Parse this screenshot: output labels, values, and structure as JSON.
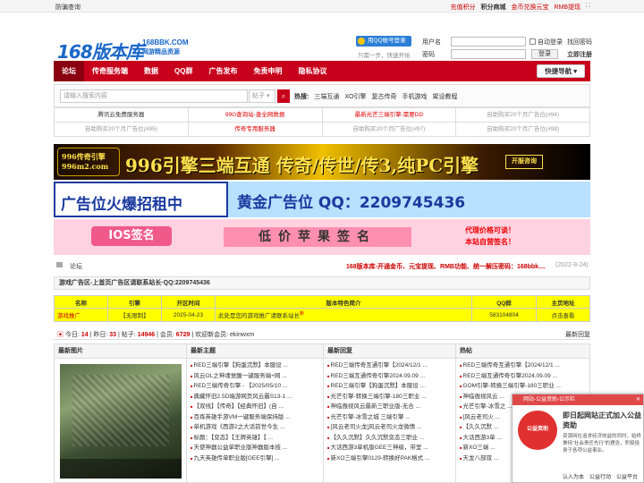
{
  "topbar": {
    "left": "防骗查询",
    "links": [
      "充值积分",
      "积分商城",
      "金币兑换元宝",
      "RMB提现"
    ]
  },
  "logo": {
    "main": "168版本库",
    "url": "168BBK.COM",
    "slogan": "网游精品资源"
  },
  "qq_login": {
    "label": "用QQ帐号登录",
    "sub": "只需一步，快速开始"
  },
  "login": {
    "user_label": "用户名",
    "pass_label": "密码",
    "auto_login": "自动登录",
    "forgot": "找回密码",
    "login_btn": "登录",
    "register": "立即注册"
  },
  "nav": {
    "items": [
      "论坛",
      "传奇服务端",
      "数据",
      "QQ群",
      "广告发布",
      "免责申明",
      "隐私协议"
    ],
    "quick": "快捷导航"
  },
  "search": {
    "placeholder": "请输入搜索内容",
    "select": "帖子",
    "hot_label": "热搜:",
    "hot": [
      "三端互通",
      "XO引擎",
      "复古传奇",
      "手机游戏",
      "架设教程"
    ]
  },
  "adlinks": [
    [
      {
        "t": "腾讯云免费服务器",
        "c": ""
      },
      {
        "t": "99G查询站-查全网数据",
        "c": "red"
      },
      {
        "t": "最新光芒三端引擎-需要DD",
        "c": "red"
      },
      {
        "t": "自助购买20个月广告位(#94)",
        "c": "gray"
      }
    ],
    [
      {
        "t": "自助购买20个月广告位(#95)",
        "c": "gray"
      },
      {
        "t": "传奇专用服务器",
        "c": "red"
      },
      {
        "t": "自助购买20个月广告位(#97)",
        "c": "gray"
      },
      {
        "t": "自助购买20个月广告位(#98)",
        "c": "gray"
      }
    ]
  ],
  "banners": {
    "b1_logo": "996传奇引擎 996m2.com",
    "b1_text": "996引擎三端互通 传奇/传世/传3,纯PC引擎",
    "b1_btn": "开服咨询",
    "b2_left": "广告位火爆招租中",
    "b2_right": "黄金广告位 QQ：2209745436",
    "b3_ios": "IOS签名",
    "b3_mid": "低价苹果签名",
    "b3_r1": "代理价格可谈！",
    "b3_r2": "本站自营签名！"
  },
  "crumb": {
    "text": "论坛",
    "news": "168版本库-开通金币、元宝提现、RMB功能、统一解压密码：168bbk....",
    "date": "(2022-8-24)"
  },
  "forum_title": "游戏广告区-上首页广告区请联系站长·QQ:2209745436",
  "ad_table": {
    "headers": [
      "名称",
      "引擎",
      "开区时间",
      "版本特色简介",
      "QQ群",
      "主页地址"
    ],
    "rows": [
      [
        "游戏推广",
        "【无限制】",
        "2025-04-23",
        "此处是您的游戏推广请联系站长",
        "583104804",
        "点击查看"
      ]
    ],
    "badge": "新"
  },
  "stats": {
    "today_l": "今日:",
    "today": "14",
    "yest_l": "昨日:",
    "yest": "33",
    "posts_l": "帖子:",
    "posts": "14946",
    "members_l": "会员:",
    "members": "6729",
    "new_l": "欢迎新会员:",
    "new": "ekinwxm",
    "latest": "最新回复"
  },
  "cols": {
    "c1": "最新图片",
    "c2": {
      "title": "最新主题",
      "items": [
        "RED三端引擎【狗蛋沉默】本服设 ...",
        "风云OL之神魂觉醒一键服务端+网 ...",
        "RED三端传奇引擎 - 【2025/05/10 ...",
        "典藏怀旧2.5D端游网页风云霸S13-1 ...",
        "【双线】【传奇】【经典怀旧】(自 ...",
        "百炼英雄手游VM一键服务端保持版 ...",
        "单机游戏《西游2之大话前世今生 ...",
        "标题：【变态】【王牌英雄】【 ...",
        "天使神器公益单职业版神器版本技 ...",
        "九天英雄传单职业版[GEE引擎] ..."
      ]
    },
    "c3": {
      "title": "最新回复",
      "items": [
        "RED三端传奇互通引擎【2024/12/1 ...",
        "RED三端互通传奇引擎2024.09.09 ...",
        "RED三端引擎【狗蛋沉默】本服设 ...",
        "光芒引擎-转换三端引擎-180三职业 ...",
        "神临傲视风云最新三职业版-无合 ...",
        "光芒引擎-冰雪之城 三端引擎 ...",
        "[风云老司火龙]风云老司火龙微情 ...",
        "【久久沉默】久久沉默变态三职业 ...",
        "大话西游3单机版GEE三神级，带室 ...",
        "新XO三端引擎0129-转换好PAK格式 ..."
      ]
    },
    "c4": {
      "title": "热帖",
      "items": [
        "RED三端传奇互通引擎【2024/12/1 ...",
        "RED三端互通传奇引擎2024.09.09 ...",
        "GOM引擎-转换三端引擎-180三职业 ...",
        "神临傲视风云 ...",
        "光芒引擎-冰雪之 ...",
        "[风云老司火 ...",
        "【久久沉默 ...",
        "大话西游3单 ...",
        "新XO三端 ...",
        "天龙八部双 ..."
      ]
    }
  },
  "popup": {
    "header": "网站-公益资助-公示栏",
    "seal": "公益资助",
    "title": "即日起网站正式加入公益资助",
    "desc": "资源网在追求经济效益的同时，始终秉持“社会责任先行”的理念，积极投身于各项公益事业。",
    "links": [
      "认入为本",
      "公益行动",
      "公益平台"
    ]
  }
}
